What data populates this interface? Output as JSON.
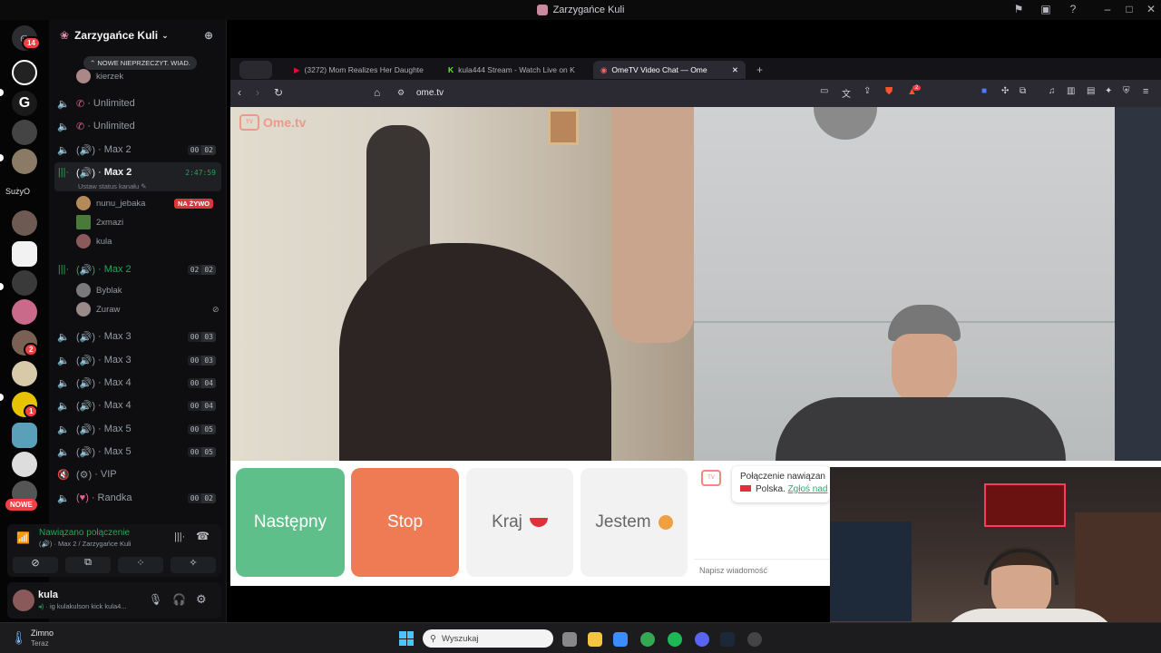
{
  "window": {
    "title": "Zarzygańce Kuli"
  },
  "rail": {
    "home_badge": "14",
    "folder_label": "SużyO",
    "badges": [
      "2",
      "1"
    ],
    "new_label": "NOWE"
  },
  "guild": {
    "name": "Zarzygańce Kuli",
    "unread_banner": "NOWE NIEPRZECZYT. WIAD.",
    "top_member": "kierzek",
    "channels": [
      {
        "name": "Unlimited",
        "counts": []
      },
      {
        "name": "Unlimited",
        "counts": []
      },
      {
        "name": "Max 2",
        "counts": [
          "00",
          "02"
        ]
      },
      {
        "name": "Max 2",
        "timer": "2:47:59",
        "status": "Ustaw status kanału"
      },
      {
        "name": "Max 2",
        "counts": [
          "02",
          "02"
        ]
      },
      {
        "name": "Max 3",
        "counts": [
          "00",
          "03"
        ]
      },
      {
        "name": "Max 3",
        "counts": [
          "00",
          "03"
        ]
      },
      {
        "name": "Max 4",
        "counts": [
          "00",
          "04"
        ]
      },
      {
        "name": "Max 4",
        "counts": [
          "00",
          "04"
        ]
      },
      {
        "name": "Max 5",
        "counts": [
          "00",
          "05"
        ]
      },
      {
        "name": "Max 5",
        "counts": [
          "00",
          "05"
        ]
      },
      {
        "name": "VIP",
        "counts": []
      },
      {
        "name": "Randka",
        "counts": [
          "00",
          "02"
        ]
      }
    ],
    "members_active": [
      "nunu_jebaka",
      "2xmazi",
      "kula"
    ],
    "live_badge": "NA ŻYWO",
    "members_second": [
      "Byblak",
      "Zuraw"
    ]
  },
  "voice": {
    "status": "Nawiązano połączenie",
    "location": "Max 2 / Zarzygańce Kuli"
  },
  "user": {
    "name": "kula",
    "status": "ig kulakulson kick kula4..."
  },
  "browser": {
    "tabs": [
      {
        "label": "(3272) Mom Realizes Her Daughte"
      },
      {
        "label": "kula444 Stream - Watch Live on K"
      },
      {
        "label": "OmeTV Video Chat — Ome"
      }
    ],
    "url": "ome.tv",
    "ext_badge": "2"
  },
  "ometv": {
    "logo": "Ome.tv",
    "next": "Następny",
    "stop": "Stop",
    "country": "Kraj",
    "me": "Jestem",
    "chat_line1": "Połączenie nawiązan",
    "chat_line2": "Polska.",
    "chat_link": "Zgłoś nad",
    "chat_placeholder": "Napisz wiadomość"
  },
  "taskbar": {
    "weather": "Zimno",
    "weather_sub": "Teraz",
    "search_placeholder": "Wyszukaj"
  },
  "colors": {
    "next": "#5fbf8a",
    "stop": "#ef7b55",
    "discord_green": "#23a55a",
    "live_red": "#da373c",
    "browser_bg": "#2b2a33"
  }
}
